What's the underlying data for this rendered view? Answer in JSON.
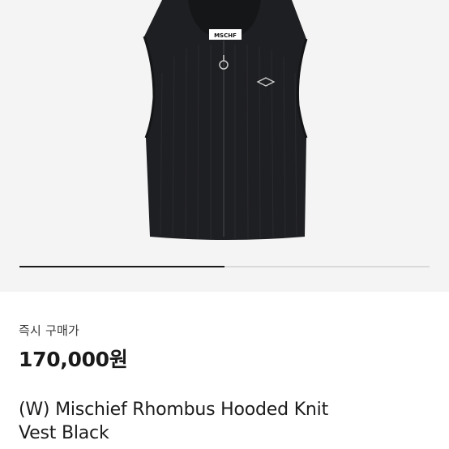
{
  "product": {
    "image_alt": "(W) Mischief Rhombus Hooded Knit Vest Black",
    "label_text": "MSCHF",
    "colors": {
      "background": "#f4f4f4",
      "garment": "#1e1f22"
    }
  },
  "gallery": {
    "progress": 0.5
  },
  "purchase": {
    "label": "즉시 구매가",
    "price": "170,000원"
  },
  "title": {
    "line1": "(W) Mischief Rhombus Hooded Knit",
    "line2": "Vest Black"
  }
}
